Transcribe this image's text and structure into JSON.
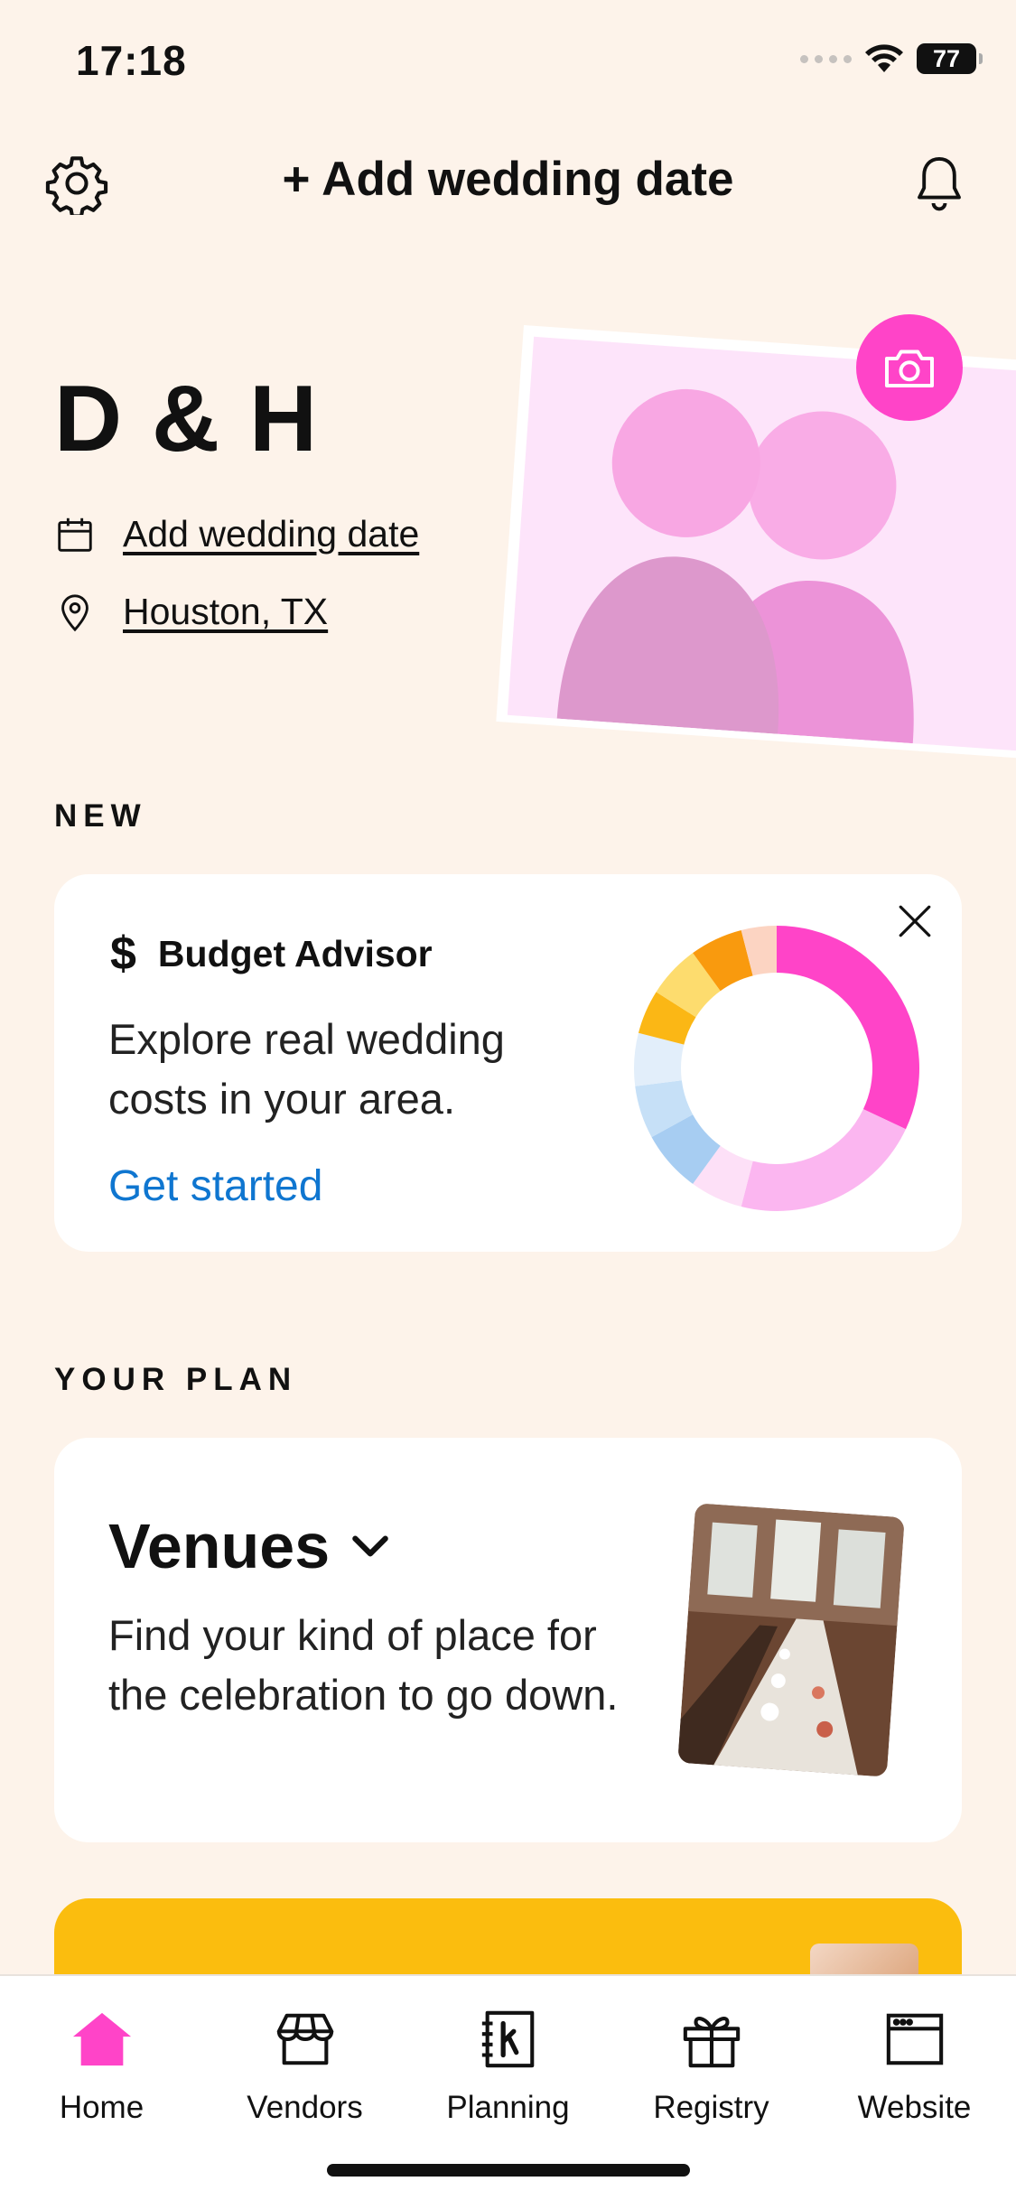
{
  "status_bar": {
    "time": "17:18",
    "battery": "77"
  },
  "top_nav": {
    "title": "+ Add wedding date"
  },
  "profile": {
    "couple_name": "D & H",
    "date_link": "Add wedding date",
    "location_link": "Houston, TX"
  },
  "sections": {
    "new": "NEW",
    "your_plan": "YOUR PLAN"
  },
  "budget_card": {
    "title": "Budget Advisor",
    "description": "Explore real wedding costs in your area.",
    "cta": "Get started",
    "donut_shares": [
      32,
      22,
      6,
      7,
      6,
      6,
      5,
      6,
      6,
      4
    ],
    "donut_colors": [
      "#ff44c8",
      "#fbb6f0",
      "#fde0f7",
      "#a7cdf2",
      "#c6e0f7",
      "#e2eefa",
      "#fbb715",
      "#fddc6e",
      "#f99a0e",
      "#fcd4c2"
    ]
  },
  "venues_card": {
    "title": "Venues",
    "description": "Find your kind of place for the celebration to go down."
  },
  "tab_bar": {
    "items": [
      {
        "label": "Home",
        "active": true
      },
      {
        "label": "Vendors",
        "active": false
      },
      {
        "label": "Planning",
        "active": false
      },
      {
        "label": "Registry",
        "active": false
      },
      {
        "label": "Website",
        "active": false
      }
    ]
  },
  "colors": {
    "accent": "#ff44c8",
    "link": "#0f76d0",
    "promo": "#fbbd0e",
    "background": "#fdf3ea"
  }
}
